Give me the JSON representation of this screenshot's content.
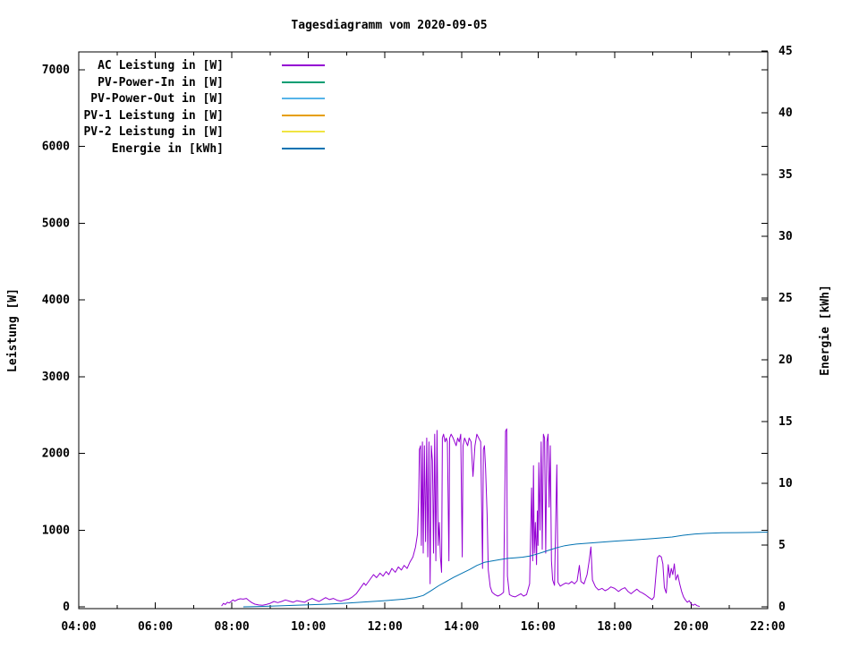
{
  "page": {
    "background": "#ffffff",
    "text_color": "#000000"
  },
  "chart_data": {
    "type": "line",
    "title": "Tagesdiagramm vom 2020-09-05",
    "grid": false,
    "legend_position": "top-left-inside",
    "x_axis": {
      "unit": "time",
      "range_hours": [
        4,
        22
      ],
      "major_tick_hours": [
        4,
        6,
        8,
        10,
        12,
        14,
        16,
        18,
        20,
        22
      ],
      "major_tick_labels": [
        "04:00",
        "06:00",
        "08:00",
        "10:00",
        "12:00",
        "14:00",
        "16:00",
        "18:00",
        "20:00",
        "22:00"
      ],
      "minor_tick_hours": [
        5,
        7,
        9,
        11,
        13,
        15,
        17,
        19,
        21
      ]
    },
    "y_left_axis": {
      "label": "Leistung [W]",
      "range": [
        0,
        7250
      ],
      "tick_values": [
        0,
        1000,
        2000,
        3000,
        4000,
        5000,
        6000,
        7000
      ]
    },
    "y_right_axis": {
      "label": "Energie [kWh]",
      "range": [
        0,
        45
      ],
      "tick_values": [
        0,
        5,
        10,
        15,
        20,
        25,
        30,
        35,
        40,
        45
      ]
    },
    "series": [
      {
        "name": "AC Leistung in [W]",
        "color": "#9400d3",
        "axis": "left",
        "points": [
          [
            7.73,
            10
          ],
          [
            7.78,
            45
          ],
          [
            7.83,
            30
          ],
          [
            7.88,
            60
          ],
          [
            7.93,
            50
          ],
          [
            7.98,
            70
          ],
          [
            8.03,
            90
          ],
          [
            8.08,
            75
          ],
          [
            8.15,
            95
          ],
          [
            8.22,
            105
          ],
          [
            8.3,
            100
          ],
          [
            8.38,
            110
          ],
          [
            8.45,
            80
          ],
          [
            8.52,
            55
          ],
          [
            8.6,
            35
          ],
          [
            8.7,
            25
          ],
          [
            8.8,
            20
          ],
          [
            8.9,
            30
          ],
          [
            9.0,
            45
          ],
          [
            9.1,
            70
          ],
          [
            9.2,
            55
          ],
          [
            9.3,
            70
          ],
          [
            9.4,
            90
          ],
          [
            9.5,
            75
          ],
          [
            9.6,
            60
          ],
          [
            9.7,
            80
          ],
          [
            9.8,
            70
          ],
          [
            9.9,
            60
          ],
          [
            10.0,
            90
          ],
          [
            10.1,
            110
          ],
          [
            10.2,
            85
          ],
          [
            10.28,
            70
          ],
          [
            10.36,
            95
          ],
          [
            10.45,
            120
          ],
          [
            10.55,
            95
          ],
          [
            10.65,
            110
          ],
          [
            10.75,
            85
          ],
          [
            10.85,
            75
          ],
          [
            10.95,
            90
          ],
          [
            11.05,
            100
          ],
          [
            11.15,
            130
          ],
          [
            11.25,
            170
          ],
          [
            11.35,
            240
          ],
          [
            11.45,
            310
          ],
          [
            11.5,
            280
          ],
          [
            11.6,
            350
          ],
          [
            11.7,
            420
          ],
          [
            11.78,
            380
          ],
          [
            11.87,
            440
          ],
          [
            11.95,
            400
          ],
          [
            12.03,
            460
          ],
          [
            12.1,
            420
          ],
          [
            12.18,
            500
          ],
          [
            12.27,
            450
          ],
          [
            12.35,
            520
          ],
          [
            12.43,
            480
          ],
          [
            12.5,
            540
          ],
          [
            12.58,
            500
          ],
          [
            12.65,
            580
          ],
          [
            12.73,
            650
          ],
          [
            12.8,
            780
          ],
          [
            12.85,
            950
          ],
          [
            12.88,
            1400
          ],
          [
            12.9,
            2050
          ],
          [
            12.93,
            2100
          ],
          [
            12.95,
            800
          ],
          [
            12.98,
            2150
          ],
          [
            13.0,
            700
          ],
          [
            13.03,
            2100
          ],
          [
            13.06,
            850
          ],
          [
            13.09,
            2200
          ],
          [
            13.12,
            650
          ],
          [
            13.15,
            2150
          ],
          [
            13.18,
            300
          ],
          [
            13.21,
            2100
          ],
          [
            13.24,
            1900
          ],
          [
            13.27,
            700
          ],
          [
            13.3,
            2250
          ],
          [
            13.33,
            600
          ],
          [
            13.36,
            2300
          ],
          [
            13.39,
            800
          ],
          [
            13.42,
            1100
          ],
          [
            13.45,
            650
          ],
          [
            13.48,
            450
          ],
          [
            13.5,
            2200
          ],
          [
            13.53,
            2250
          ],
          [
            13.57,
            2150
          ],
          [
            13.6,
            2200
          ],
          [
            13.63,
            2150
          ],
          [
            13.67,
            600
          ],
          [
            13.69,
            2200
          ],
          [
            13.73,
            2250
          ],
          [
            13.78,
            2200
          ],
          [
            13.82,
            2150
          ],
          [
            13.86,
            2100
          ],
          [
            13.9,
            2200
          ],
          [
            13.94,
            2150
          ],
          [
            13.98,
            2250
          ],
          [
            14.02,
            650
          ],
          [
            14.04,
            2100
          ],
          [
            14.08,
            2200
          ],
          [
            14.12,
            2150
          ],
          [
            14.16,
            2100
          ],
          [
            14.2,
            2200
          ],
          [
            14.25,
            2150
          ],
          [
            14.3,
            1700
          ],
          [
            14.35,
            2100
          ],
          [
            14.4,
            2250
          ],
          [
            14.45,
            2200
          ],
          [
            14.5,
            2150
          ],
          [
            14.55,
            500
          ],
          [
            14.57,
            2050
          ],
          [
            14.6,
            2100
          ],
          [
            14.63,
            1800
          ],
          [
            14.67,
            1200
          ],
          [
            14.7,
            480
          ],
          [
            14.75,
            260
          ],
          [
            14.8,
            190
          ],
          [
            14.87,
            160
          ],
          [
            14.95,
            140
          ],
          [
            15.03,
            160
          ],
          [
            15.1,
            190
          ],
          [
            15.15,
            2290
          ],
          [
            15.18,
            2320
          ],
          [
            15.2,
            400
          ],
          [
            15.25,
            160
          ],
          [
            15.32,
            140
          ],
          [
            15.4,
            130
          ],
          [
            15.48,
            150
          ],
          [
            15.55,
            170
          ],
          [
            15.62,
            140
          ],
          [
            15.7,
            160
          ],
          [
            15.78,
            300
          ],
          [
            15.83,
            1550
          ],
          [
            15.86,
            600
          ],
          [
            15.88,
            1840
          ],
          [
            15.9,
            700
          ],
          [
            15.93,
            1100
          ],
          [
            15.96,
            550
          ],
          [
            15.98,
            1250
          ],
          [
            16.0,
            800
          ],
          [
            16.02,
            1880
          ],
          [
            16.05,
            1000
          ],
          [
            16.08,
            2150
          ],
          [
            16.11,
            750
          ],
          [
            16.14,
            2250
          ],
          [
            16.17,
            2200
          ],
          [
            16.2,
            700
          ],
          [
            16.23,
            2150
          ],
          [
            16.26,
            2250
          ],
          [
            16.29,
            1300
          ],
          [
            16.32,
            2100
          ],
          [
            16.35,
            600
          ],
          [
            16.38,
            350
          ],
          [
            16.43,
            280
          ],
          [
            16.49,
            1850
          ],
          [
            16.52,
            320
          ],
          [
            16.58,
            270
          ],
          [
            16.65,
            290
          ],
          [
            16.72,
            310
          ],
          [
            16.8,
            300
          ],
          [
            16.88,
            330
          ],
          [
            16.95,
            300
          ],
          [
            17.02,
            340
          ],
          [
            17.08,
            540
          ],
          [
            17.12,
            330
          ],
          [
            17.2,
            300
          ],
          [
            17.28,
            420
          ],
          [
            17.33,
            580
          ],
          [
            17.38,
            780
          ],
          [
            17.42,
            350
          ],
          [
            17.5,
            260
          ],
          [
            17.58,
            220
          ],
          [
            17.67,
            240
          ],
          [
            17.75,
            210
          ],
          [
            17.83,
            230
          ],
          [
            17.9,
            260
          ],
          [
            18.0,
            240
          ],
          [
            18.1,
            200
          ],
          [
            18.18,
            230
          ],
          [
            18.27,
            250
          ],
          [
            18.35,
            200
          ],
          [
            18.43,
            170
          ],
          [
            18.5,
            200
          ],
          [
            18.58,
            230
          ],
          [
            18.65,
            200
          ],
          [
            18.73,
            180
          ],
          [
            18.82,
            150
          ],
          [
            18.9,
            120
          ],
          [
            18.98,
            95
          ],
          [
            19.03,
            130
          ],
          [
            19.08,
            420
          ],
          [
            19.12,
            640
          ],
          [
            19.17,
            670
          ],
          [
            19.22,
            650
          ],
          [
            19.26,
            560
          ],
          [
            19.3,
            250
          ],
          [
            19.35,
            180
          ],
          [
            19.4,
            550
          ],
          [
            19.44,
            380
          ],
          [
            19.48,
            500
          ],
          [
            19.52,
            420
          ],
          [
            19.56,
            560
          ],
          [
            19.6,
            350
          ],
          [
            19.65,
            420
          ],
          [
            19.7,
            300
          ],
          [
            19.75,
            200
          ],
          [
            19.8,
            130
          ],
          [
            19.85,
            90
          ],
          [
            19.9,
            60
          ],
          [
            19.95,
            80
          ],
          [
            20.0,
            40
          ],
          [
            20.05,
            20
          ],
          [
            20.1,
            35
          ],
          [
            20.15,
            15
          ],
          [
            20.22,
            5
          ]
        ]
      },
      {
        "name": "PV-Power-In in [W]",
        "color": "#009e73",
        "axis": "left",
        "points": []
      },
      {
        "name": "PV-Power-Out in [W]",
        "color": "#56b4e9",
        "axis": "left",
        "points": []
      },
      {
        "name": "PV-1 Leistung in [W]",
        "color": "#e69f00",
        "axis": "left",
        "points": []
      },
      {
        "name": "PV-2 Leistung in [W]",
        "color": "#f0e442",
        "axis": "left",
        "points": []
      },
      {
        "name": "Energie in [kWh]",
        "color": "#0072b2",
        "axis": "right",
        "points": [
          [
            8.3,
            0
          ],
          [
            8.6,
            0.02
          ],
          [
            9.0,
            0.06
          ],
          [
            9.5,
            0.11
          ],
          [
            10.0,
            0.16
          ],
          [
            10.5,
            0.22
          ],
          [
            11.0,
            0.3
          ],
          [
            11.5,
            0.4
          ],
          [
            12.0,
            0.5
          ],
          [
            12.5,
            0.62
          ],
          [
            12.8,
            0.75
          ],
          [
            13.0,
            0.92
          ],
          [
            13.2,
            1.3
          ],
          [
            13.4,
            1.7
          ],
          [
            13.6,
            2.05
          ],
          [
            13.8,
            2.4
          ],
          [
            14.0,
            2.7
          ],
          [
            14.2,
            3.0
          ],
          [
            14.4,
            3.35
          ],
          [
            14.6,
            3.6
          ],
          [
            14.8,
            3.72
          ],
          [
            15.0,
            3.82
          ],
          [
            15.2,
            3.92
          ],
          [
            15.4,
            3.97
          ],
          [
            15.6,
            4.02
          ],
          [
            15.8,
            4.12
          ],
          [
            16.0,
            4.3
          ],
          [
            16.15,
            4.45
          ],
          [
            16.3,
            4.6
          ],
          [
            16.5,
            4.8
          ],
          [
            16.7,
            4.95
          ],
          [
            17.0,
            5.08
          ],
          [
            17.5,
            5.2
          ],
          [
            18.0,
            5.32
          ],
          [
            18.5,
            5.42
          ],
          [
            19.0,
            5.52
          ],
          [
            19.5,
            5.65
          ],
          [
            19.8,
            5.8
          ],
          [
            20.1,
            5.9
          ],
          [
            20.4,
            5.95
          ],
          [
            20.8,
            5.99
          ],
          [
            21.2,
            6.01
          ],
          [
            21.6,
            6.02
          ],
          [
            22.0,
            6.05
          ]
        ]
      }
    ]
  }
}
